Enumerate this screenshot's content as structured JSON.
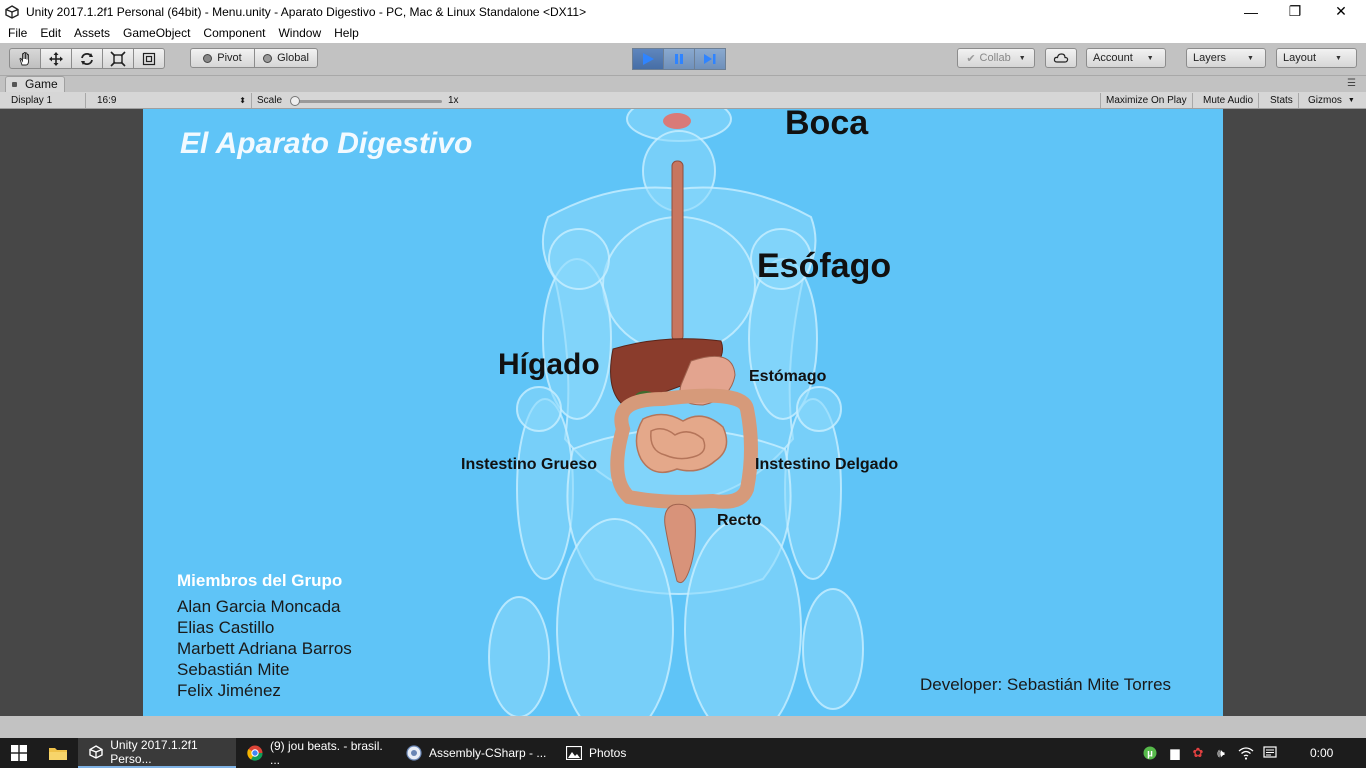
{
  "window": {
    "title": "Unity 2017.1.2f1 Personal (64bit) - Menu.unity - Aparato Digestivo - PC, Mac & Linux Standalone <DX11>",
    "controls": {
      "minimize": "—",
      "restore": "❐",
      "close": "✕"
    }
  },
  "menu": [
    "File",
    "Edit",
    "Assets",
    "GameObject",
    "Component",
    "Window",
    "Help"
  ],
  "toolbar": {
    "pivot": "Pivot",
    "global": "Global",
    "collab": "Collab",
    "account": "Account",
    "layers": "Layers",
    "layout": "Layout"
  },
  "game_tab": {
    "label": "Game",
    "display": "Display 1",
    "aspect": "16:9",
    "scale_label": "Scale",
    "scale_value": "1x",
    "maximize": "Maximize On Play",
    "mute": "Mute Audio",
    "stats": "Stats",
    "gizmos": "Gizmos"
  },
  "game": {
    "title": "El Aparato Digestivo",
    "labels": {
      "boca": "Boca",
      "esofago": "Esófago",
      "higado": "Hígado",
      "estomago": "Estómago",
      "grueso": "Instestino Grueso",
      "delgado": "Instestino Delgado",
      "recto": "Recto"
    },
    "members_heading": "Miembros del Grupo",
    "members": [
      "Alan Garcia Moncada",
      "Elias Castillo",
      "Marbett Adriana Barros",
      "Sebastián Mite",
      "Felix Jiménez"
    ],
    "developer": "Developer: Sebastián Mite Torres"
  },
  "taskbar": {
    "items": [
      "Unity 2017.1.2f1 Perso...",
      "(9) jou beats. - brasil. ...",
      "Assembly-CSharp - ...",
      "Photos"
    ],
    "clock": "0:00"
  },
  "colors": {
    "viewport_bg": "#5fc4f7",
    "play_active": "#466ea6"
  }
}
